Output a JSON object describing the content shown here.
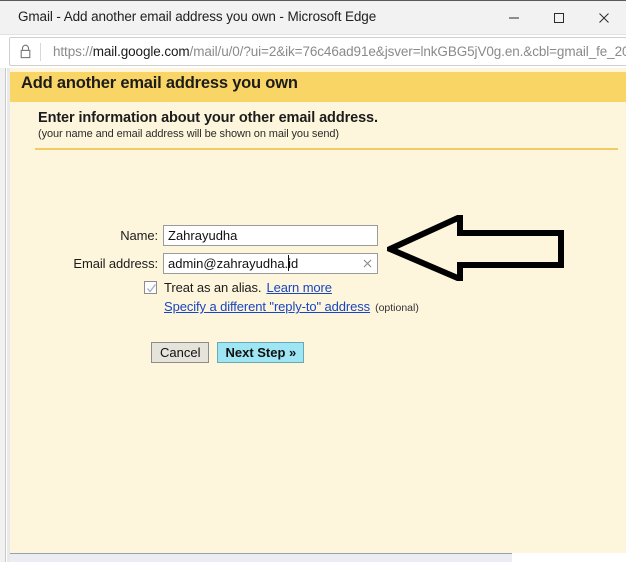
{
  "window": {
    "title": "Gmail - Add another email address you own - Microsoft Edge",
    "minimize_label": "Minimize",
    "maximize_label": "Maximize",
    "close_label": "Close"
  },
  "address_bar": {
    "lock_icon": "padlock-icon",
    "url_scheme": "https://",
    "url_host": "mail.google.com",
    "url_path": "/mail/u/0/?ui=2&ik=76c46ad91e&jsver=lnkGBG5jV0g.en.&cbl=gmail_fe_20"
  },
  "page": {
    "header_title": "Add another email address you own",
    "section_title": "Enter information about your other email address.",
    "section_subtitle": "(your name and email address will be shown on mail you send)",
    "fields": {
      "name": {
        "label": "Name:",
        "value": "Zahrayudha",
        "placeholder": ""
      },
      "email": {
        "label": "Email address:",
        "value": "admin@zahrayudha.id",
        "placeholder": "",
        "clear_icon": "clear-x-icon"
      }
    },
    "alias": {
      "checkbox_icon": "checkmark-icon",
      "checked": "true",
      "label": "Treat as an alias.",
      "learn_more": "Learn more"
    },
    "reply_to": {
      "link": "Specify a different \"reply-to\" address",
      "optional": "(optional)"
    },
    "buttons": {
      "cancel": "Cancel",
      "next_step": "Next Step »"
    },
    "annotation": {
      "arrow_icon": "left-pointing-arrow-icon"
    }
  },
  "colors": {
    "header_yellow": "#f8d565",
    "body_cream": "#fdf6dc",
    "divider_gold": "#f0cd63",
    "link_blue": "#1a45c0",
    "next_button_cyan": "#9fe6f5",
    "cancel_button_gray": "#e6e3db"
  }
}
